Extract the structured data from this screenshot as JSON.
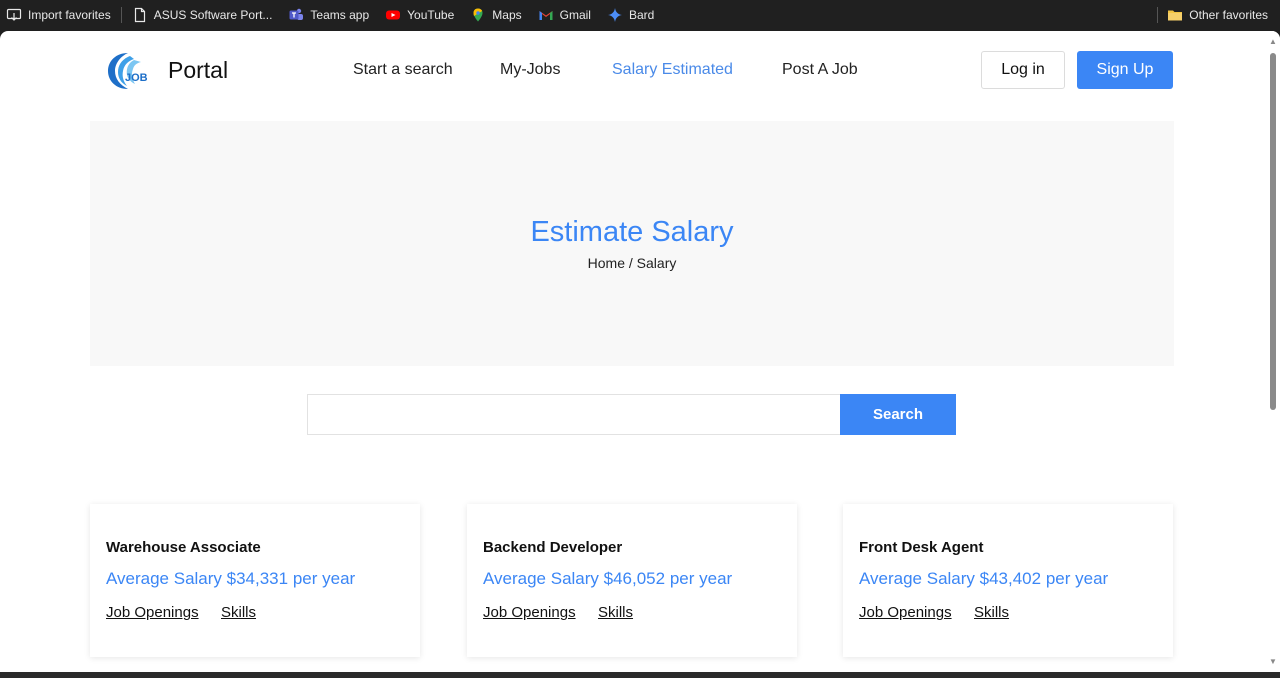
{
  "bookmarks": {
    "items": [
      {
        "label": "Import favorites",
        "icon": "import-icon"
      },
      {
        "label": "ASUS Software Port...",
        "icon": "page-icon"
      },
      {
        "label": "Teams app",
        "icon": "teams-icon"
      },
      {
        "label": "YouTube",
        "icon": "youtube-icon"
      },
      {
        "label": "Maps",
        "icon": "maps-icon"
      },
      {
        "label": "Gmail",
        "icon": "gmail-icon"
      },
      {
        "label": "Bard",
        "icon": "bard-icon"
      }
    ],
    "other": {
      "label": "Other favorites",
      "icon": "folder-icon"
    }
  },
  "nav": {
    "logo_text": "JOB",
    "brand": "Portal",
    "links": [
      "Start a search",
      "My-Jobs",
      "Salary Estimated",
      "Post A Job"
    ],
    "active_index": 2,
    "login_label": "Log in",
    "signup_label": "Sign Up"
  },
  "hero": {
    "title": "Estimate Salary",
    "breadcrumb_home": "Home",
    "breadcrumb_sep": "/",
    "breadcrumb_current": "Salary"
  },
  "search": {
    "value": "",
    "placeholder": "",
    "button_label": "Search"
  },
  "cards": [
    {
      "title": "Warehouse Associate",
      "salary": "Average Salary $34,331 per year",
      "link1": "Job Openings",
      "link2": "Skills"
    },
    {
      "title": "Backend Developer",
      "salary": "Average Salary $46,052 per year",
      "link1": "Job Openings",
      "link2": "Skills"
    },
    {
      "title": "Front Desk Agent",
      "salary": "Average Salary $43,402 per year",
      "link1": "Job Openings",
      "link2": "Skills"
    }
  ],
  "colors": {
    "accent": "#3b86f5",
    "hero_bg": "#f8f8f8",
    "bookmarks_bg": "#202020"
  }
}
